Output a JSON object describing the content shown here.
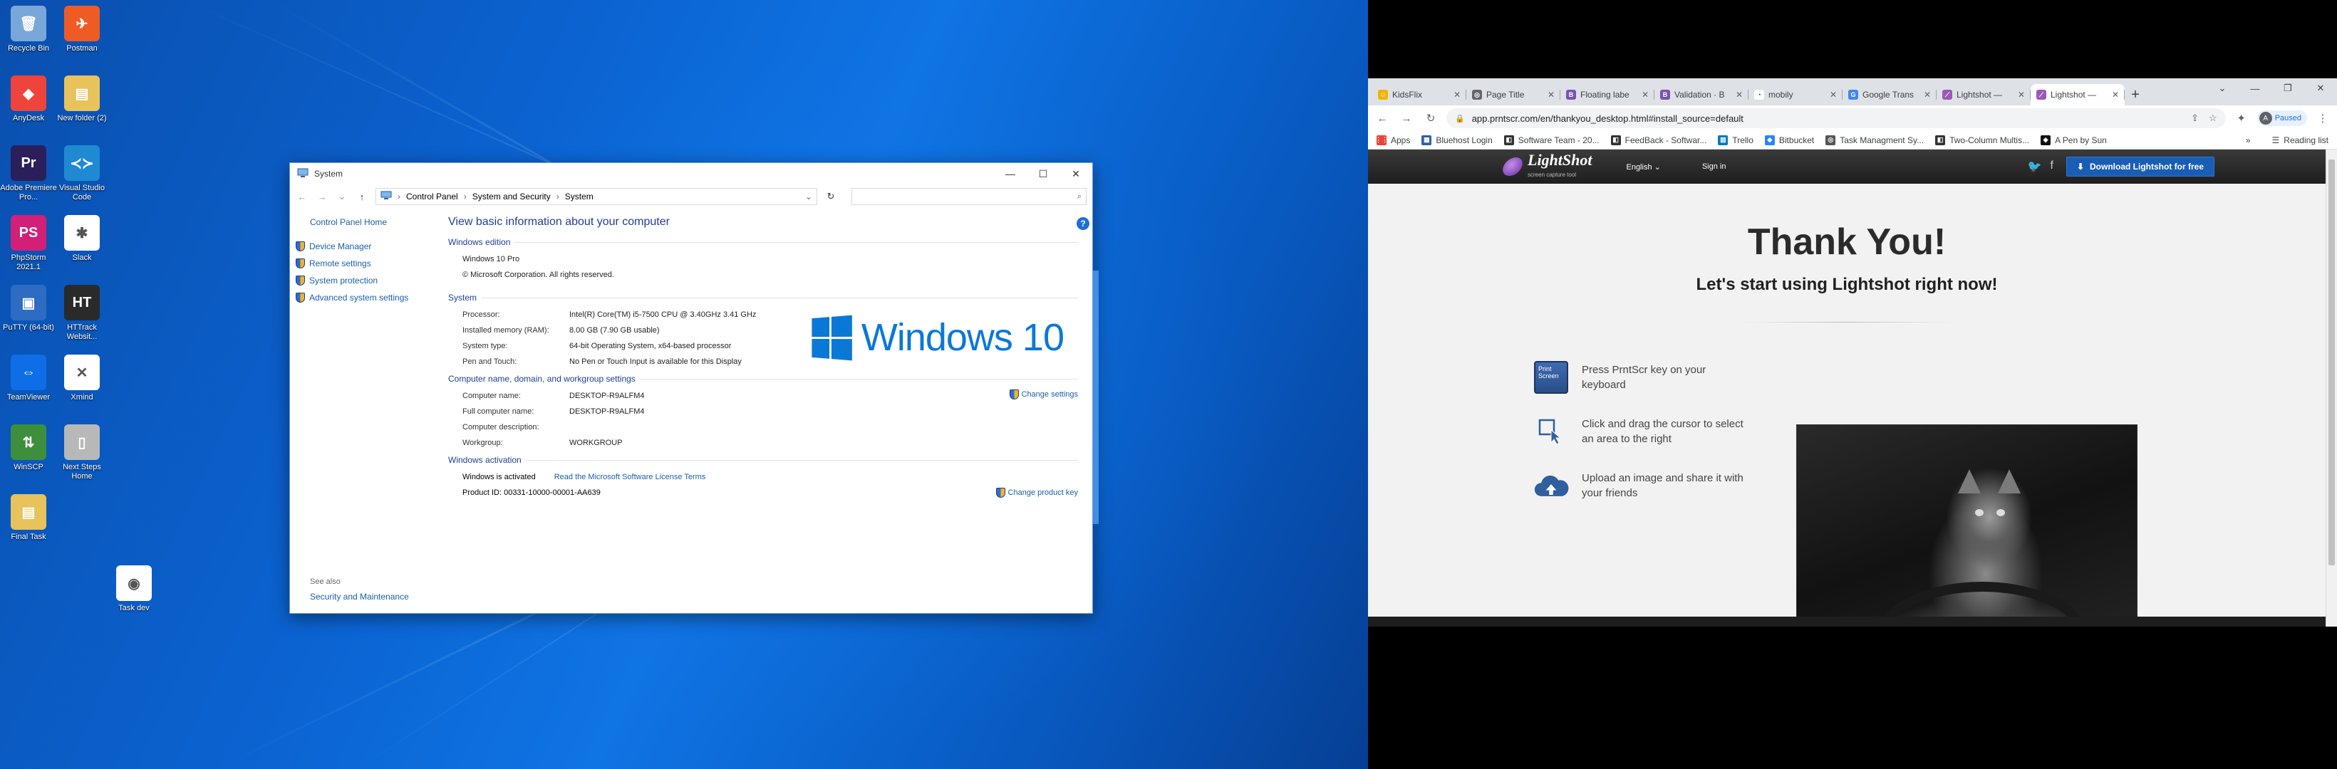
{
  "desktop": {
    "icons": [
      {
        "label": "Recycle Bin",
        "color": "#7aa7d9",
        "glyph": "🗑"
      },
      {
        "label": "Postman",
        "color": "#ef5b25",
        "glyph": "✈"
      },
      {
        "label": "AnyDesk",
        "color": "#ef443b",
        "glyph": "◆"
      },
      {
        "label": "New folder (2)",
        "color": "#e8c25a",
        "glyph": "▤"
      },
      {
        "label": "Adobe Premiere Pro...",
        "color": "#2a1f5a",
        "glyph": "Pr"
      },
      {
        "label": "Visual Studio Code",
        "color": "#1f8ad2",
        "glyph": "≺≻"
      },
      {
        "label": "PhpStorm 2021.1",
        "color": "#d21f78",
        "glyph": "PS"
      },
      {
        "label": "Slack",
        "color": "#ffffff",
        "glyph": "✱"
      },
      {
        "label": "PuTTY (64-bit)",
        "color": "#2d6cc2",
        "glyph": "▣"
      },
      {
        "label": "HTTrack Websit...",
        "color": "#2a2a2a",
        "glyph": "HT"
      },
      {
        "label": "TeamViewer",
        "color": "#0e6ee8",
        "glyph": "⇔"
      },
      {
        "label": "Xmind",
        "color": "#ffffff",
        "glyph": "✕"
      },
      {
        "label": "WinSCP",
        "color": "#3d8f3d",
        "glyph": "⇅"
      },
      {
        "label": "Next Steps Home",
        "color": "#b8b8b8",
        "glyph": "▯"
      },
      {
        "label": "Final Task",
        "color": "#e8c25a",
        "glyph": "▤"
      },
      {
        "label": "Task dev",
        "color": "#ffffff",
        "glyph": "◉"
      }
    ]
  },
  "system_window": {
    "title": "System",
    "window_controls": [
      "—",
      "☐",
      "✕"
    ],
    "nav": {
      "back": "←",
      "forward": "→",
      "recent": "⌄",
      "up": "↑"
    },
    "breadcrumb": [
      "Control Panel",
      "System and Security",
      "System"
    ],
    "breadcrumb_sep": "›",
    "refresh": "↻",
    "dropdown": "⌄",
    "search_icon": "⌕",
    "left_pane": {
      "home": "Control Panel Home",
      "links": [
        "Device Manager",
        "Remote settings",
        "System protection",
        "Advanced system settings"
      ],
      "see_also": "See also",
      "see_also_link": "Security and Maintenance"
    },
    "heading": "View basic information about your computer",
    "help": "?",
    "logo_text": "Windows 10",
    "edition": {
      "title": "Windows edition",
      "name": "Windows 10 Pro",
      "copyright": "© Microsoft Corporation. All rights reserved."
    },
    "system": {
      "title": "System",
      "rows": [
        {
          "k": "Processor:",
          "v": "Intel(R) Core(TM) i5-7500 CPU @ 3.40GHz   3.41 GHz"
        },
        {
          "k": "Installed memory (RAM):",
          "v": "8.00 GB (7.90 GB usable)"
        },
        {
          "k": "System type:",
          "v": "64-bit Operating System, x64-based processor"
        },
        {
          "k": "Pen and Touch:",
          "v": "No Pen or Touch Input is available for this Display"
        }
      ]
    },
    "computer": {
      "title": "Computer name, domain, and workgroup settings",
      "change": "Change settings",
      "rows": [
        {
          "k": "Computer name:",
          "v": "DESKTOP-R9ALFM4"
        },
        {
          "k": "Full computer name:",
          "v": "DESKTOP-R9ALFM4"
        },
        {
          "k": "Computer description:",
          "v": ""
        },
        {
          "k": "Workgroup:",
          "v": "WORKGROUP"
        }
      ]
    },
    "activation": {
      "title": "Windows activation",
      "status": "Windows is activated",
      "license_link": "Read the Microsoft Software License Terms",
      "product_id": "Product ID: 00331-10000-00001-AA639",
      "change_key": "Change product key"
    }
  },
  "browser": {
    "tabs": [
      {
        "title": "KidsFlix",
        "color": "#f2b300",
        "glyph": "☺"
      },
      {
        "title": "Page Title",
        "color": "#666666",
        "glyph": "◎"
      },
      {
        "title": "Floating labe",
        "color": "#7952b3",
        "glyph": "B"
      },
      {
        "title": "Validation · B",
        "color": "#7952b3",
        "glyph": "B"
      },
      {
        "title": "mobily",
        "color": "#ffffff",
        "glyph": "◔"
      },
      {
        "title": "Google Trans",
        "color": "#4285f4",
        "glyph": "G"
      },
      {
        "title": "Lightshot —",
        "color": "#9b59b6",
        "glyph": "⟋"
      },
      {
        "title": "Lightshot —",
        "color": "#9b59b6",
        "glyph": "⟋"
      }
    ],
    "active_tab": 7,
    "tab_close": "✕",
    "new_tab": "+",
    "window_controls": [
      "⌄",
      "—",
      "❐",
      "✕"
    ],
    "nav": {
      "back": "←",
      "forward": "→",
      "reload": "↻"
    },
    "lock": "🔒",
    "url": "app.prntscr.com/en/thankyou_desktop.html#install_source=default",
    "omni_icons": [
      "⇪",
      "☆"
    ],
    "extensions_icon": "✦",
    "profile": {
      "initial": "A",
      "status": "Paused"
    },
    "menu_icon": "⋮",
    "bookmarks": [
      {
        "label": "Apps",
        "color": "#ea4335",
        "glyph": "⋮⋮"
      },
      {
        "label": "Bluehost Login",
        "color": "#2f5faa",
        "glyph": "▦"
      },
      {
        "label": "Software Team - 20...",
        "color": "#333333",
        "glyph": "◧"
      },
      {
        "label": "FeedBack - Softwar...",
        "color": "#333333",
        "glyph": "◧"
      },
      {
        "label": "Trello",
        "color": "#0079bf",
        "glyph": "▥"
      },
      {
        "label": "Bitbucket",
        "color": "#2684ff",
        "glyph": "◆"
      },
      {
        "label": "Task Managment Sy...",
        "color": "#555555",
        "glyph": "◎"
      },
      {
        "label": "Two-Column Multis...",
        "color": "#333333",
        "glyph": "◧"
      },
      {
        "label": "A Pen by Sun",
        "color": "#111111",
        "glyph": "◈"
      }
    ],
    "bookmarks_more": "»",
    "reading_list": "Reading list"
  },
  "lightshot": {
    "brand": "LightShot",
    "tagline": "screen capture tool",
    "language": "English ⌄",
    "signin": "Sign in",
    "social": [
      "🐦",
      "f"
    ],
    "download": "Download Lightshot for free",
    "download_icon": "⬇",
    "title": "Thank You!",
    "subtitle": "Let's start using Lightshot right now!",
    "key_label": "Print Screen",
    "steps": [
      {
        "text": "Press PrntScr key on your keyboard",
        "icon": "key-icon"
      },
      {
        "text": "Click and drag the cursor to select an area to the right",
        "icon": "select-area-icon"
      },
      {
        "text": "Upload an image and share it with your friends",
        "icon": "cloud-upload-icon"
      }
    ],
    "image_alt": "cat"
  }
}
